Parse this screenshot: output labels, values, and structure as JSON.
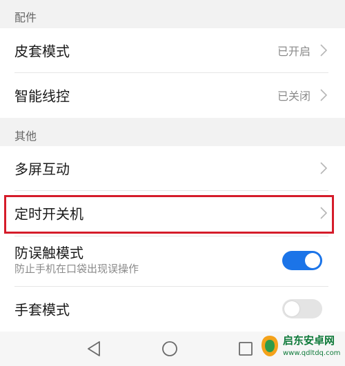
{
  "sections": {
    "accessories": "配件",
    "others": "其他"
  },
  "items": {
    "case_mode": {
      "label": "皮套模式",
      "value": "已开启"
    },
    "smart_remote": {
      "label": "智能线控",
      "value": "已关闭"
    },
    "multi_screen": {
      "label": "多屏互动"
    },
    "scheduled_power": {
      "label": "定时开关机"
    },
    "anti_touch": {
      "label": "防误触模式",
      "subtitle": "防止手机在口袋出现误操作",
      "toggle": "on"
    },
    "glove_mode": {
      "label": "手套模式",
      "toggle": "off"
    }
  },
  "colors": {
    "accent": "#1b74e8",
    "highlight": "#d51c2a"
  },
  "icons": [
    "chevron-right-icon",
    "back-triangle-icon",
    "home-circle-icon",
    "recents-square-icon"
  ],
  "watermark": {
    "title": "启东安卓网",
    "url": "www.qdltdq.com"
  }
}
